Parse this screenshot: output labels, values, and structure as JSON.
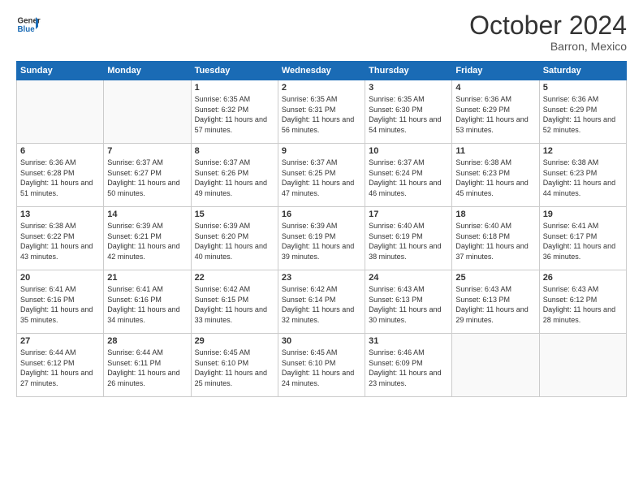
{
  "logo": {
    "line1": "General",
    "line2": "Blue"
  },
  "title": "October 2024",
  "location": "Barron, Mexico",
  "days_header": [
    "Sunday",
    "Monday",
    "Tuesday",
    "Wednesday",
    "Thursday",
    "Friday",
    "Saturday"
  ],
  "weeks": [
    [
      {
        "day": "",
        "info": ""
      },
      {
        "day": "",
        "info": ""
      },
      {
        "day": "1",
        "info": "Sunrise: 6:35 AM\nSunset: 6:32 PM\nDaylight: 11 hours and 57 minutes."
      },
      {
        "day": "2",
        "info": "Sunrise: 6:35 AM\nSunset: 6:31 PM\nDaylight: 11 hours and 56 minutes."
      },
      {
        "day": "3",
        "info": "Sunrise: 6:35 AM\nSunset: 6:30 PM\nDaylight: 11 hours and 54 minutes."
      },
      {
        "day": "4",
        "info": "Sunrise: 6:36 AM\nSunset: 6:29 PM\nDaylight: 11 hours and 53 minutes."
      },
      {
        "day": "5",
        "info": "Sunrise: 6:36 AM\nSunset: 6:29 PM\nDaylight: 11 hours and 52 minutes."
      }
    ],
    [
      {
        "day": "6",
        "info": "Sunrise: 6:36 AM\nSunset: 6:28 PM\nDaylight: 11 hours and 51 minutes."
      },
      {
        "day": "7",
        "info": "Sunrise: 6:37 AM\nSunset: 6:27 PM\nDaylight: 11 hours and 50 minutes."
      },
      {
        "day": "8",
        "info": "Sunrise: 6:37 AM\nSunset: 6:26 PM\nDaylight: 11 hours and 49 minutes."
      },
      {
        "day": "9",
        "info": "Sunrise: 6:37 AM\nSunset: 6:25 PM\nDaylight: 11 hours and 47 minutes."
      },
      {
        "day": "10",
        "info": "Sunrise: 6:37 AM\nSunset: 6:24 PM\nDaylight: 11 hours and 46 minutes."
      },
      {
        "day": "11",
        "info": "Sunrise: 6:38 AM\nSunset: 6:23 PM\nDaylight: 11 hours and 45 minutes."
      },
      {
        "day": "12",
        "info": "Sunrise: 6:38 AM\nSunset: 6:23 PM\nDaylight: 11 hours and 44 minutes."
      }
    ],
    [
      {
        "day": "13",
        "info": "Sunrise: 6:38 AM\nSunset: 6:22 PM\nDaylight: 11 hours and 43 minutes."
      },
      {
        "day": "14",
        "info": "Sunrise: 6:39 AM\nSunset: 6:21 PM\nDaylight: 11 hours and 42 minutes."
      },
      {
        "day": "15",
        "info": "Sunrise: 6:39 AM\nSunset: 6:20 PM\nDaylight: 11 hours and 40 minutes."
      },
      {
        "day": "16",
        "info": "Sunrise: 6:39 AM\nSunset: 6:19 PM\nDaylight: 11 hours and 39 minutes."
      },
      {
        "day": "17",
        "info": "Sunrise: 6:40 AM\nSunset: 6:19 PM\nDaylight: 11 hours and 38 minutes."
      },
      {
        "day": "18",
        "info": "Sunrise: 6:40 AM\nSunset: 6:18 PM\nDaylight: 11 hours and 37 minutes."
      },
      {
        "day": "19",
        "info": "Sunrise: 6:41 AM\nSunset: 6:17 PM\nDaylight: 11 hours and 36 minutes."
      }
    ],
    [
      {
        "day": "20",
        "info": "Sunrise: 6:41 AM\nSunset: 6:16 PM\nDaylight: 11 hours and 35 minutes."
      },
      {
        "day": "21",
        "info": "Sunrise: 6:41 AM\nSunset: 6:16 PM\nDaylight: 11 hours and 34 minutes."
      },
      {
        "day": "22",
        "info": "Sunrise: 6:42 AM\nSunset: 6:15 PM\nDaylight: 11 hours and 33 minutes."
      },
      {
        "day": "23",
        "info": "Sunrise: 6:42 AM\nSunset: 6:14 PM\nDaylight: 11 hours and 32 minutes."
      },
      {
        "day": "24",
        "info": "Sunrise: 6:43 AM\nSunset: 6:13 PM\nDaylight: 11 hours and 30 minutes."
      },
      {
        "day": "25",
        "info": "Sunrise: 6:43 AM\nSunset: 6:13 PM\nDaylight: 11 hours and 29 minutes."
      },
      {
        "day": "26",
        "info": "Sunrise: 6:43 AM\nSunset: 6:12 PM\nDaylight: 11 hours and 28 minutes."
      }
    ],
    [
      {
        "day": "27",
        "info": "Sunrise: 6:44 AM\nSunset: 6:12 PM\nDaylight: 11 hours and 27 minutes."
      },
      {
        "day": "28",
        "info": "Sunrise: 6:44 AM\nSunset: 6:11 PM\nDaylight: 11 hours and 26 minutes."
      },
      {
        "day": "29",
        "info": "Sunrise: 6:45 AM\nSunset: 6:10 PM\nDaylight: 11 hours and 25 minutes."
      },
      {
        "day": "30",
        "info": "Sunrise: 6:45 AM\nSunset: 6:10 PM\nDaylight: 11 hours and 24 minutes."
      },
      {
        "day": "31",
        "info": "Sunrise: 6:46 AM\nSunset: 6:09 PM\nDaylight: 11 hours and 23 minutes."
      },
      {
        "day": "",
        "info": ""
      },
      {
        "day": "",
        "info": ""
      }
    ]
  ]
}
